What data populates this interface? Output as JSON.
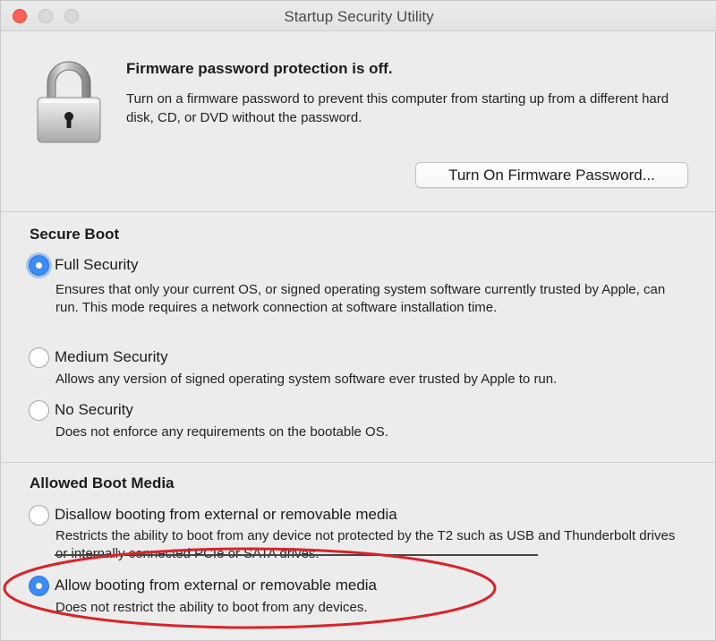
{
  "window": {
    "title": "Startup Security Utility"
  },
  "firmware": {
    "heading": "Firmware password protection is off.",
    "description": "Turn on a firmware password to prevent this computer from starting up from a different hard disk, CD, or DVD without the password.",
    "button_label": "Turn On Firmware Password..."
  },
  "secure_boot": {
    "heading": "Secure Boot",
    "options": [
      {
        "label": "Full Security",
        "description": "Ensures that only your current OS, or signed operating system software currently trusted by Apple, can run. This mode requires a network connection at software installation time.",
        "selected": true
      },
      {
        "label": "Medium Security",
        "description": "Allows any version of signed operating system software ever trusted by Apple to run.",
        "selected": false
      },
      {
        "label": "No Security",
        "description": "Does not enforce any requirements on the bootable OS.",
        "selected": false
      }
    ]
  },
  "boot_media": {
    "heading": "Allowed Boot Media",
    "options": [
      {
        "label": "Disallow booting from external or removable media",
        "description": "Restricts the ability to boot from any device not protected by the T2 such as USB and Thunderbolt drives or internally connected PCIe or SATA drives.",
        "selected": false
      },
      {
        "label": "Allow booting from external or removable media",
        "description": "Does not restrict the ability to boot from any devices.",
        "selected": true
      }
    ]
  },
  "colors": {
    "accent": "#3e8af6",
    "highlight_ellipse": "#d9232a"
  },
  "icons": {
    "lock": "padlock-icon"
  }
}
